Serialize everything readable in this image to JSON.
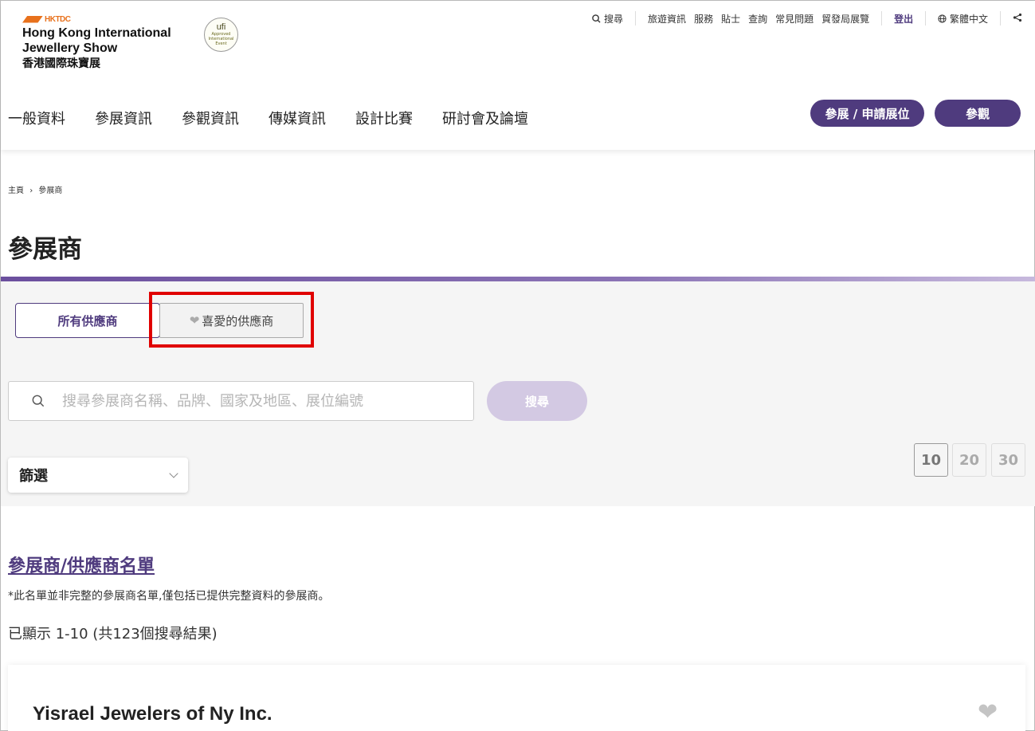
{
  "header": {
    "brand": "HKTDC",
    "show_name_line1": "Hong Kong International",
    "show_name_line2": "Jewellery Show",
    "show_name_zh": "香港國際珠寶展",
    "ufi_badge": "ufi",
    "ufi_sub1": "Approved",
    "ufi_sub2": "International",
    "ufi_sub3": "Event"
  },
  "top_links": {
    "search": "搜尋",
    "items": [
      "旅遊資訊",
      "服務",
      "貼士",
      "查詢",
      "常見問題",
      "貿發局展覽"
    ],
    "logout": "登出",
    "language": "繁體中文"
  },
  "main_nav": [
    "一般資料",
    "參展資訊",
    "參觀資訊",
    "傳媒資訊",
    "設計比賽",
    "研討會及論壇"
  ],
  "actions": {
    "exhibit": "參展 / 申請展位",
    "visit": "參觀"
  },
  "breadcrumb": {
    "home": "主頁",
    "separator": "›",
    "current": "參展商"
  },
  "page_title": "參展商",
  "tabs": {
    "all": "所有供應商",
    "favourites": "喜愛的供應商"
  },
  "search": {
    "placeholder": "搜尋參展商名稱、品牌、國家及地區、展位編號",
    "button": "搜尋"
  },
  "filter": {
    "label": "篩選"
  },
  "page_sizes": [
    "10",
    "20",
    "30"
  ],
  "results": {
    "title": "參展商/供應商名單",
    "note": "*此名單並非完整的參展商名單,僅包括已提供完整資料的參展商。",
    "count": "已顯示 1-10 (共123個搜尋結果)"
  },
  "exhibitors": [
    {
      "name": "Yisrael Jewelers of Ny Inc."
    }
  ],
  "colors": {
    "brand_purple": "#4f3b7e",
    "orange": "#e8711c",
    "highlight_red": "#e00000",
    "search_button": "#d3c9e3"
  }
}
